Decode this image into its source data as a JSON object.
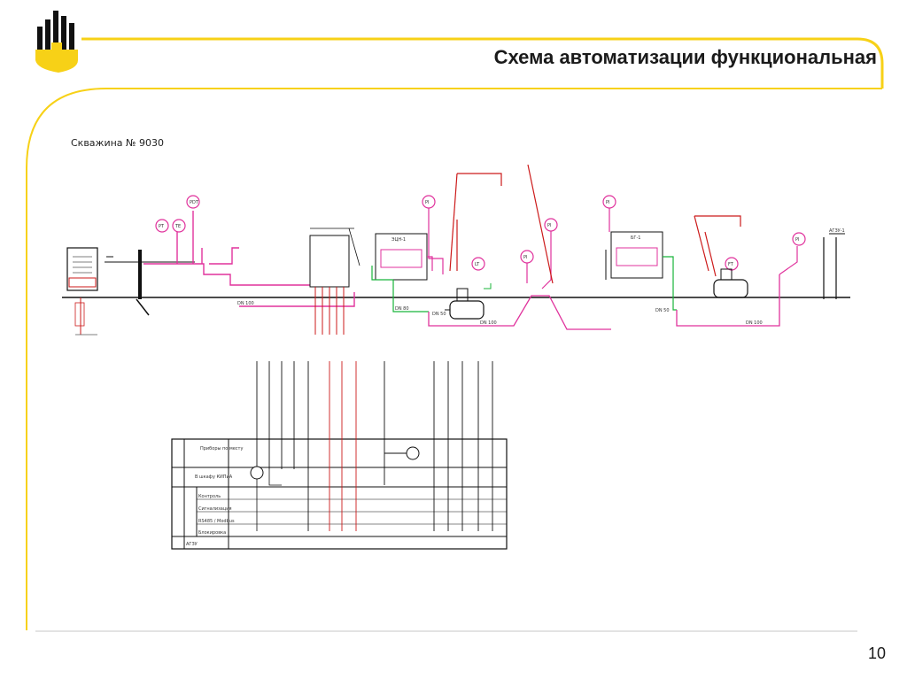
{
  "header": {
    "title": "Схема автоматизации функциональная",
    "logo_icon": "rosneft-logo-icon",
    "accent_color": "#f7d117",
    "logo_black": "#111111"
  },
  "diagram": {
    "well_label": "Скважина № 9030",
    "box_pump": "ЭЦН-1",
    "box_measure_1": "АГЗУ-1",
    "box_measure_2": "БГ-1",
    "dn_labels": [
      "DN 100",
      "DN 80",
      "DN 50",
      "DN 50",
      "DN 100",
      "DN 100"
    ],
    "tags": [
      "PT",
      "TE",
      "PDT",
      "PI",
      "PI",
      "PI",
      "PI",
      "PI",
      "LT",
      "FT"
    ],
    "line_colors": {
      "process": "#e0329c",
      "signal": "#cc1a1a",
      "green": "#18b43a",
      "black": "#111111"
    }
  },
  "table": {
    "row_labels": [
      "Приборы по месту",
      "В шкафу КИПиА",
      "Контроль",
      "Сигнализация",
      "RS485 / Modbus",
      "Блокировка",
      "АГЗУ"
    ]
  },
  "footer": {
    "page_number": "10"
  }
}
